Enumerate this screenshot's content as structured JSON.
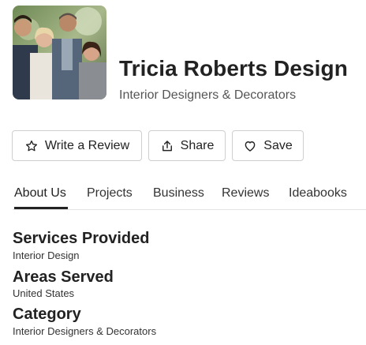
{
  "profile": {
    "name": "Tricia Roberts Design",
    "category": "Interior Designers & Decorators"
  },
  "actions": {
    "review_label": "Write a Review",
    "share_label": "Share",
    "save_label": "Save"
  },
  "tabs": [
    {
      "label": "About Us",
      "active": true
    },
    {
      "label": "Projects"
    },
    {
      "label": "Business"
    },
    {
      "label": "Reviews"
    },
    {
      "label": "Ideabooks"
    }
  ],
  "about": {
    "services_heading": "Services Provided",
    "services_value": "Interior Design",
    "areas_heading": "Areas Served",
    "areas_value": "United States",
    "category_heading": "Category",
    "category_value": "Interior Designers & Decorators"
  },
  "icons": {
    "review": "star-outline-icon",
    "share": "share-upload-icon",
    "save": "heart-outline-icon"
  }
}
